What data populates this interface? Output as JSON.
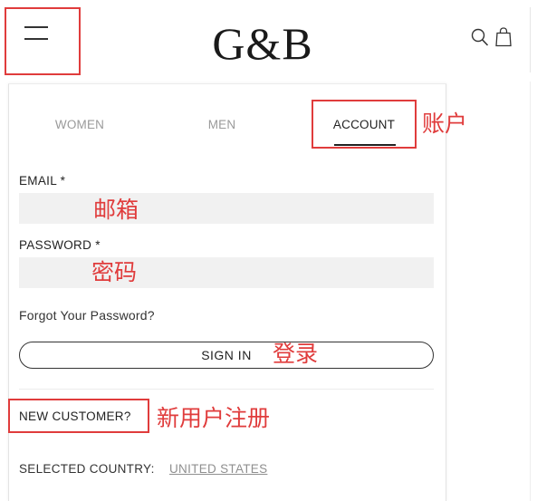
{
  "header": {
    "logo_text": "G&B",
    "menu_icon": "hamburger-menu-icon",
    "search_icon": "search-icon",
    "bag_icon": "shopping-bag-icon"
  },
  "tabs": [
    {
      "label": "WOMEN",
      "active": false
    },
    {
      "label": "MEN",
      "active": false
    },
    {
      "label": "ACCOUNT",
      "active": true
    }
  ],
  "annotations": {
    "account": "账户",
    "email": "邮箱",
    "password": "密码",
    "sign_in": "登录",
    "new_customer": "新用户注册",
    "color": "#e03c3c"
  },
  "form": {
    "email_label": "EMAIL *",
    "email_value": "",
    "password_label": "PASSWORD *",
    "password_value": "",
    "forgot_label": "Forgot Your Password?",
    "sign_in_label": "SIGN IN"
  },
  "new_customer": {
    "label": "NEW CUSTOMER?"
  },
  "country": {
    "label": "SELECTED COUNTRY:",
    "value": "UNITED STATES"
  }
}
